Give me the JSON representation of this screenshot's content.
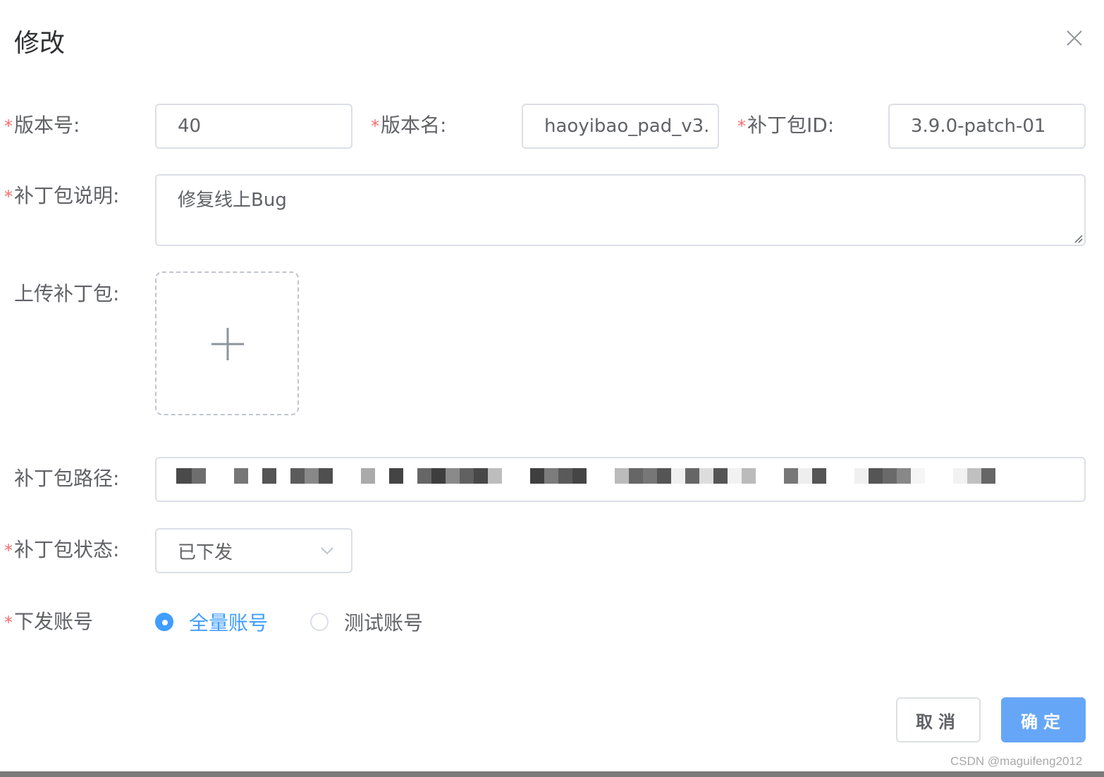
{
  "dialog": {
    "title": "修改",
    "close_icon": "close-icon"
  },
  "form": {
    "required_mark": "*",
    "version_code": {
      "label": "版本号:",
      "value": "40"
    },
    "version_name": {
      "label": "版本名:",
      "value": "haoyibao_pad_v3."
    },
    "patch_id": {
      "label": "补丁包ID:",
      "value": "3.9.0-patch-01"
    },
    "patch_desc": {
      "label": "补丁包说明:",
      "value": "修复线上Bug"
    },
    "upload": {
      "label": "上传补丁包:",
      "icon": "plus-icon"
    },
    "patch_path": {
      "label": "补丁包路径:"
    },
    "patch_status": {
      "label": "补丁包状态:",
      "value": "已下发",
      "icon": "chevron-down-icon"
    },
    "accounts": {
      "label": "下发账号",
      "options": [
        {
          "label": "全量账号",
          "checked": true
        },
        {
          "label": "测试账号",
          "checked": false
        }
      ]
    }
  },
  "footer": {
    "cancel_label": "取消",
    "confirm_label": "确定"
  },
  "watermark": "CSDN @maguifeng2012",
  "colors": {
    "primary": "#409eff",
    "confirm_button": "#66a6f7",
    "required": "#f56c6c",
    "border": "#dcdfe6"
  }
}
